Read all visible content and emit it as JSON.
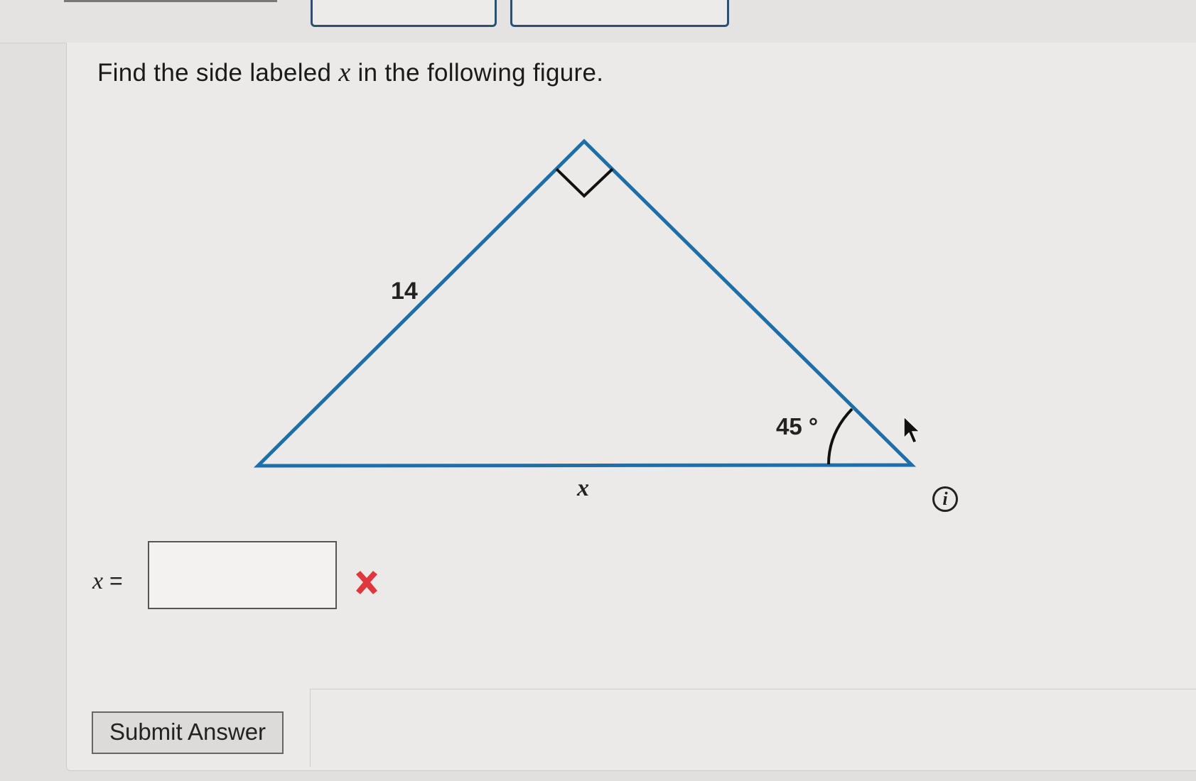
{
  "question": {
    "prefix": "Find the side labeled ",
    "variable": "x",
    "suffix": " in the following figure."
  },
  "figure": {
    "side_label": "14",
    "angle_label": "45 °",
    "base_label": "x",
    "line_color": "#1e6fa8"
  },
  "answer": {
    "variable": "x",
    "equals": " =",
    "value": "",
    "status": "incorrect",
    "status_color": "#e0373f"
  },
  "submit_label": "Submit Answer",
  "icons": {
    "info": "info-icon",
    "wrong": "x-mark-icon",
    "cursor": "mouse-pointer-icon"
  }
}
